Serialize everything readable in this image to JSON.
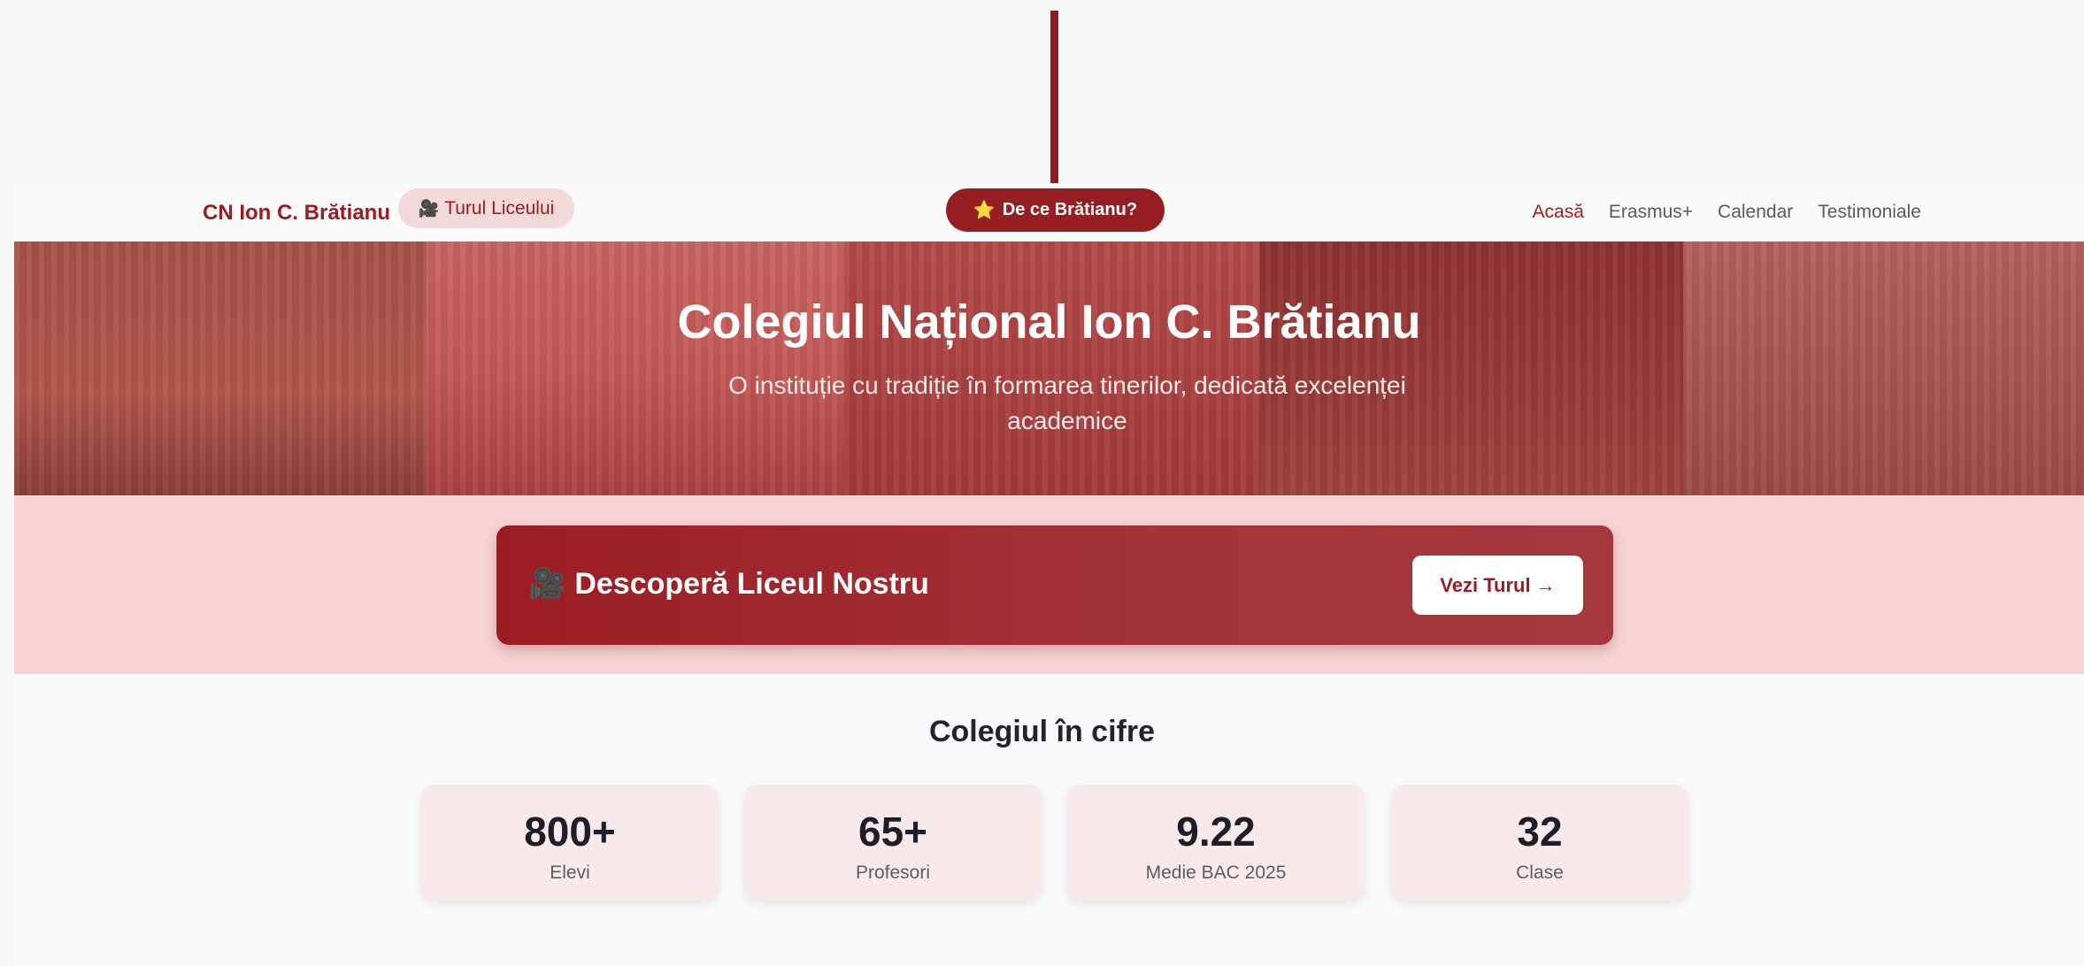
{
  "navbar": {
    "brand": "CN Ion C. Brătianu",
    "tour_chip": {
      "icon": "🎥",
      "label": "Turul Liceului"
    },
    "why_button": {
      "icon": "⭐",
      "label": "De ce Brătianu?"
    },
    "links": [
      {
        "label": "Acasă",
        "active": true
      },
      {
        "label": "Erasmus+",
        "active": false
      },
      {
        "label": "Calendar",
        "active": false
      },
      {
        "label": "Testimoniale",
        "active": false
      }
    ]
  },
  "hero": {
    "title": "Colegiul Național Ion C. Brătianu",
    "subtitle": "O instituție cu tradiție în formarea tinerilor, dedicată excelenței academice"
  },
  "discover": {
    "icon": "🎥",
    "title": "Descoperă Liceul Nostru",
    "button": "Vezi Turul →"
  },
  "stats": {
    "title": "Colegiul în cifre",
    "items": [
      {
        "value": "800+",
        "label": "Elevi"
      },
      {
        "value": "65+",
        "label": "Profesori"
      },
      {
        "value": "9.22",
        "label": "Medie BAC 2025"
      },
      {
        "value": "32",
        "label": "Clase"
      }
    ]
  },
  "colors": {
    "brand": "#9b1c22",
    "accent": "#961d22",
    "active_link": "#b3171d"
  }
}
